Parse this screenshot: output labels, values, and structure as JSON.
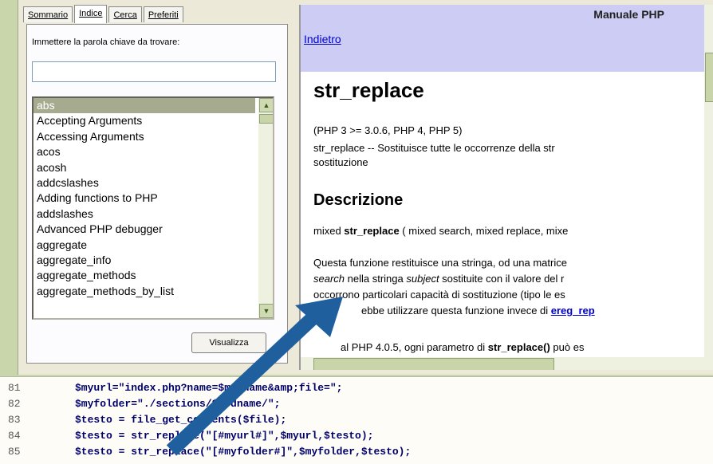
{
  "left": {
    "tabs": [
      "Sommario",
      "Indice",
      "Cerca",
      "Preferiti"
    ],
    "active_tab": "Indice",
    "prompt": "Immettere la parola chiave da trovare:",
    "search_value": "",
    "list_items": [
      "abs",
      "Accepting Arguments",
      "Accessing Arguments",
      "acos",
      "acosh",
      "addcslashes",
      "Adding functions to PHP",
      "addslashes",
      "Advanced PHP debugger",
      "aggregate",
      "aggregate_info",
      "aggregate_methods",
      "aggregate_methods_by_list"
    ],
    "selected_item": "abs",
    "show_button": "Visualizza"
  },
  "right": {
    "manual_title": "Manuale PHP",
    "back_link": "Indietro",
    "func_title": "str_replace",
    "versions": "(PHP 3 >= 3.0.6, PHP 4, PHP 5)",
    "summary1": "str_replace --  Sostituisce tutte le occorrenze della str",
    "summary2": "sostituzione",
    "desc_heading": "Descrizione",
    "signature_pre": "mixed ",
    "signature_fn": "str_replace",
    "signature_post": " ( mixed search, mixed replace, mixe",
    "para1": "Questa funzione restituisce una stringa, od una matrice",
    "para2_a": "search",
    "para2_b": " nella stringa ",
    "para2_c": "subject",
    "para2_d": " sostituite con il valore del r",
    "para3": "occorrono particolari capacità di sostituzione (tipo le es",
    "para4_pre": "ebbe utilizzare questa funzione invece di ",
    "para4_link": "ereg_rep",
    "para5_pre": "al PHP 4.0.5, ogni parametro di ",
    "para5_fn": "str_replace()",
    "para5_post": " può es"
  },
  "code": [
    {
      "num": "81",
      "text": "$myurl=\"index.php?name=$modname&amp;file=\";"
    },
    {
      "num": "82",
      "text": "$myfolder=\"./sections/$modname/\";"
    },
    {
      "num": "83",
      "text": "$testo = file_get_contents($file);"
    },
    {
      "num": "84",
      "text": "$testo = str_replace(\"[#myurl#]\",$myurl,$testo);"
    },
    {
      "num": "85",
      "text": "$testo = str_replace(\"[#myfolder#]\",$myfolder,$testo);"
    }
  ],
  "colors": {
    "arrow": "#1f5f9e",
    "header_bg": "#ccccf5",
    "selection": "#a6ab8f",
    "link": "#0000cc"
  }
}
